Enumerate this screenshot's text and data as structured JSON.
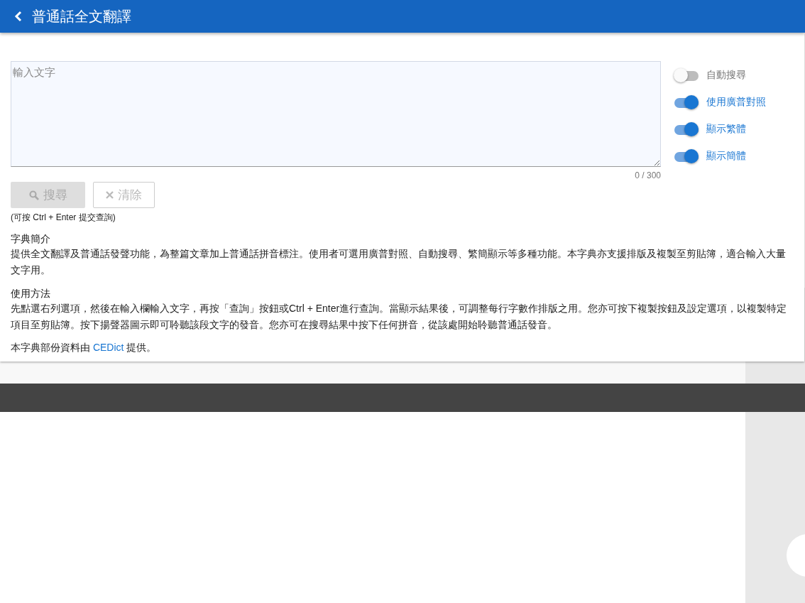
{
  "header": {
    "title": "普通話全文翻譯"
  },
  "input": {
    "placeholder": "輸入文字",
    "counter": "0 / 300"
  },
  "buttons": [
    {
      "kind": "search",
      "label": "搜尋",
      "disabled": true
    },
    {
      "kind": "clear",
      "label": "清除",
      "disabled": true
    }
  ],
  "hint": "(可按 Ctrl + Enter 提交查詢)",
  "toggles": [
    {
      "label": "自動搜尋",
      "on": false
    },
    {
      "label": "使用廣普對照",
      "on": true
    },
    {
      "label": "顯示繁體",
      "on": true
    },
    {
      "label": "顯示簡體",
      "on": true
    }
  ],
  "sections": [
    {
      "heading": "字典簡介",
      "body": "提供全文翻譯及普通話發聲功能，為整篇文章加上普通話拼音標注。使用者可選用廣普對照、自動搜尋、繁簡顯示等多種功能。本字典亦支援排版及複製至剪貼簿，適合輸入大量文字用。"
    },
    {
      "heading": "使用方法",
      "body": "先點選右列選項，然後在輸入欄輸入文字，再按「查詢」按鈕或Ctrl + Enter進行查詢。當顯示結果後，可調整每行字數作排版之用。您亦可按下複製按鈕及設定選項，以複製特定項目至剪貼簿。按下揚聲器圖示即可聆聽該段文字的發音。您亦可在搜尋結果中按下任何拼音，從該處開始聆聽普通話發音。"
    }
  ],
  "credit": {
    "before": "本字典部份資料由 ",
    "link": "CEDict",
    "after": " 提供。"
  }
}
